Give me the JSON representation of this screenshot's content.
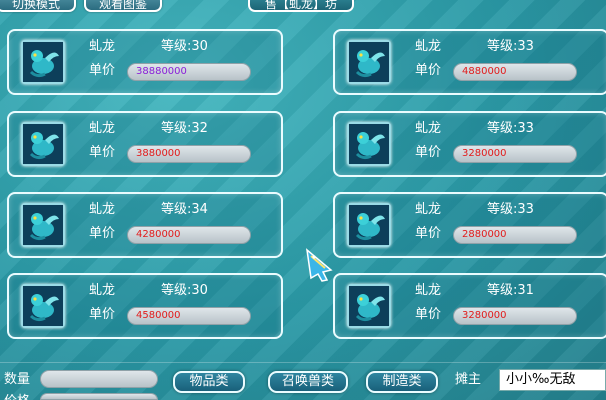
{
  "top_bar": {
    "switch_mode_label": "切换模式",
    "view_gallery_label": "观看图鉴",
    "shop_title": "售【虬龙】坊"
  },
  "labels": {
    "level_prefix": "等级:",
    "price_label": "单价"
  },
  "listings": [
    {
      "name": "虬龙",
      "level": "30",
      "price": "38880000",
      "price_color": "#8a1ed8"
    },
    {
      "name": "虬龙",
      "level": "33",
      "price": "4880000",
      "price_color": "#e21b1b"
    },
    {
      "name": "虬龙",
      "level": "32",
      "price": "3880000",
      "price_color": "#e21b1b"
    },
    {
      "name": "虬龙",
      "level": "33",
      "price": "3280000",
      "price_color": "#e21b1b"
    },
    {
      "name": "虬龙",
      "level": "34",
      "price": "4280000",
      "price_color": "#e21b1b"
    },
    {
      "name": "虬龙",
      "level": "33",
      "price": "2880000",
      "price_color": "#e21b1b"
    },
    {
      "name": "虬龙",
      "level": "30",
      "price": "4580000",
      "price_color": "#e21b1b"
    },
    {
      "name": "虬龙",
      "level": "31",
      "price": "3280000",
      "price_color": "#e21b1b"
    }
  ],
  "bottom": {
    "quantity_label": "数量",
    "quantity_value": "",
    "price_label": "价格",
    "price_value": "",
    "items_button": "物品类",
    "summon_button": "召唤兽类",
    "crafting_button": "制造类",
    "seller_label": "摊主",
    "seller_name": "小小‰无敌"
  },
  "colors": {
    "background": "#2a9ca8",
    "price_default": "#e21b1b",
    "price_highlight": "#8a1ed8"
  },
  "icons": {
    "pet": "dragon-pet-icon",
    "cursor": "fish-cursor-icon"
  }
}
